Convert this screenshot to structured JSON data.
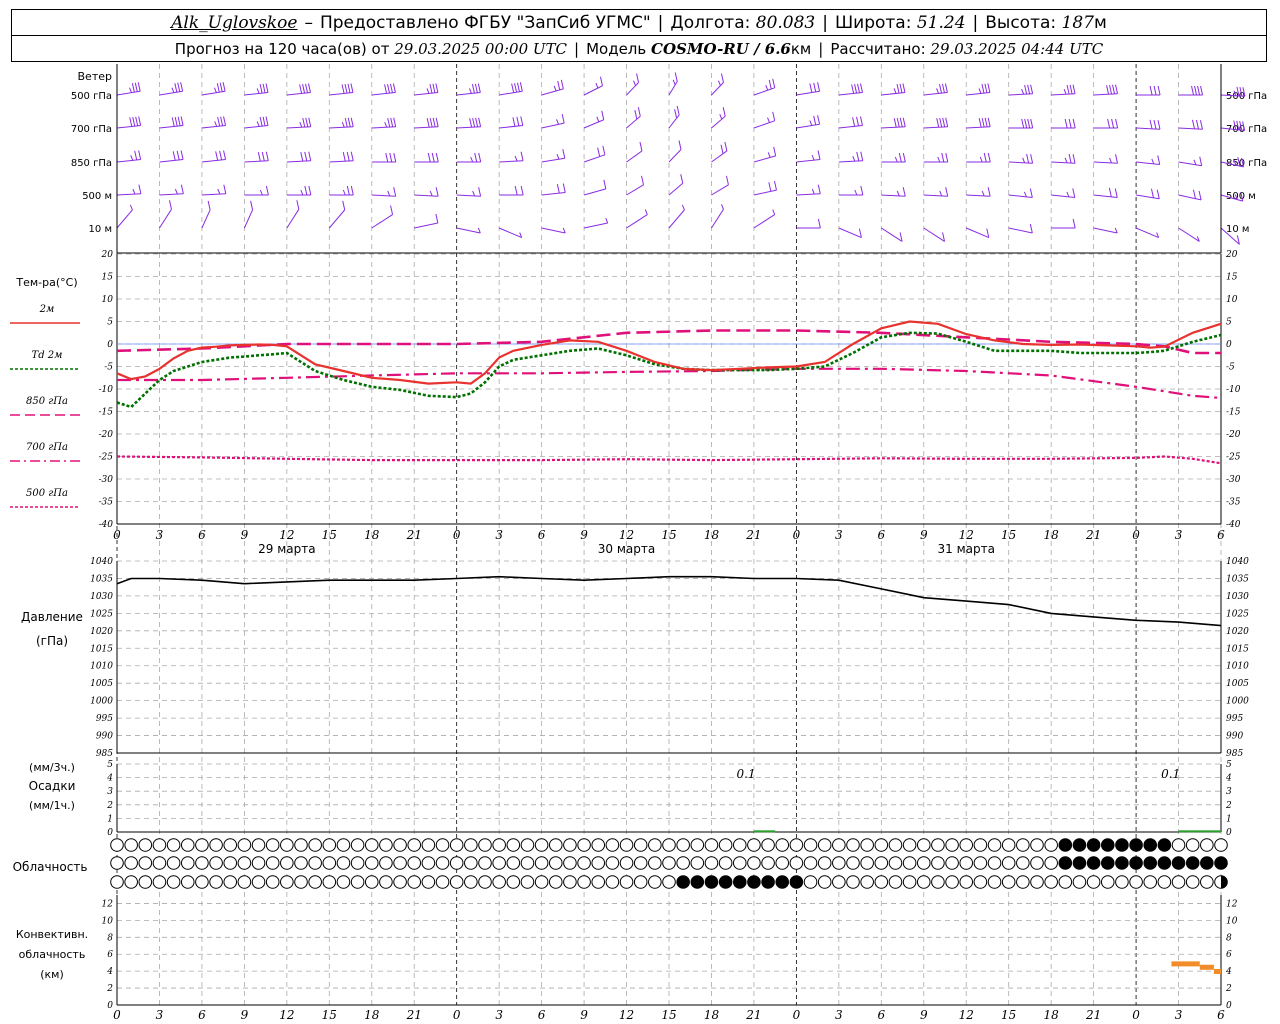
{
  "header": {
    "station": "Alk_Uglovskoe",
    "provider": "Предоставлено ФГБУ \"ЗапСиб УГМС\"",
    "lon_label": "Долгота:",
    "lon": "80.083",
    "lat_label": "Широта:",
    "lat": "51.24",
    "alt_label": "Высота:",
    "alt": "187",
    "alt_unit": "м",
    "forecast_label": "Прогноз на 120 часа(ов) от",
    "forecast_start": "29.03.2025 00:00 UTC",
    "model_label": "Модель",
    "model": "COSMO-RU / 6.6",
    "model_unit": "км",
    "computed_label": "Рассчитано:",
    "computed": "29.03.2025 04:44 UTC"
  },
  "colors": {
    "wind": "#8a2be2",
    "t2m": "#e8322e",
    "td2m": "#007000",
    "t850": "#e0107a",
    "t700": "#e0107a",
    "t500": "#e0107a",
    "pressure": "#000000",
    "conv": "#f28c28",
    "precip": "#2ca02c",
    "grid": "#aaaaaa"
  },
  "chart_data": {
    "x": {
      "hours": [
        0,
        3,
        6,
        9,
        12,
        15,
        18,
        21,
        24,
        27,
        30,
        33,
        36,
        39,
        42,
        45,
        48,
        51,
        54,
        57,
        60,
        63,
        66,
        69,
        72,
        75,
        78
      ],
      "tick_labels": [
        "0",
        "3",
        "6",
        "9",
        "12",
        "15",
        "18",
        "21",
        "0",
        "3",
        "6",
        "9",
        "12",
        "15",
        "18",
        "21",
        "0",
        "3",
        "6",
        "9",
        "12",
        "15",
        "18",
        "21",
        "0",
        "3",
        "6"
      ],
      "dates": [
        {
          "label": "29 марта",
          "hour": 12
        },
        {
          "label": "30 марта",
          "hour": 36
        },
        {
          "label": "31 марта",
          "hour": 60
        }
      ]
    },
    "wind": {
      "title": "Ветер",
      "levels": [
        "500 гПа",
        "700 гПа",
        "850 гПа",
        "500 м",
        "10 м"
      ],
      "speed_ms": [
        [
          22,
          23,
          24,
          24,
          25,
          25,
          25,
          24,
          22,
          18,
          14,
          12,
          10,
          10,
          12,
          14,
          16,
          18,
          20,
          20,
          20,
          20,
          20,
          18,
          16,
          18,
          20
        ],
        [
          18,
          19,
          20,
          20,
          21,
          21,
          20,
          19,
          18,
          15,
          12,
          10,
          8,
          8,
          10,
          12,
          14,
          16,
          18,
          18,
          18,
          18,
          17,
          16,
          15,
          16,
          18
        ],
        [
          14,
          15,
          16,
          16,
          17,
          17,
          16,
          15,
          14,
          12,
          10,
          8,
          6,
          6,
          8,
          10,
          12,
          13,
          14,
          14,
          14,
          14,
          13,
          12,
          11,
          12,
          14
        ],
        [
          11,
          12,
          12,
          12,
          13,
          13,
          12,
          11,
          10,
          9,
          8,
          6,
          5,
          5,
          6,
          8,
          10,
          11,
          12,
          12,
          11,
          11,
          10,
          9,
          8,
          9,
          11
        ],
        [
          4,
          5,
          5,
          5,
          6,
          6,
          5,
          5,
          4,
          4,
          4,
          3,
          3,
          3,
          3,
          4,
          5,
          5,
          6,
          6,
          6,
          5,
          5,
          4,
          4,
          4,
          5
        ]
      ],
      "dir_deg": [
        [
          285,
          285,
          285,
          280,
          280,
          280,
          280,
          280,
          280,
          285,
          295,
          310,
          330,
          340,
          330,
          300,
          285,
          280,
          280,
          280,
          280,
          275,
          275,
          275,
          270,
          270,
          265
        ],
        [
          280,
          280,
          280,
          280,
          275,
          275,
          275,
          275,
          275,
          280,
          290,
          305,
          325,
          335,
          325,
          300,
          285,
          280,
          275,
          275,
          275,
          270,
          270,
          270,
          265,
          265,
          260
        ],
        [
          280,
          280,
          280,
          275,
          275,
          275,
          270,
          270,
          270,
          275,
          285,
          300,
          320,
          330,
          320,
          295,
          280,
          275,
          270,
          270,
          270,
          265,
          265,
          265,
          260,
          255,
          250
        ],
        [
          275,
          275,
          275,
          270,
          270,
          270,
          265,
          265,
          265,
          270,
          280,
          295,
          315,
          325,
          315,
          290,
          275,
          270,
          265,
          265,
          265,
          260,
          260,
          260,
          255,
          250,
          245
        ],
        [
          320,
          330,
          340,
          340,
          330,
          320,
          300,
          280,
          260,
          250,
          260,
          280,
          300,
          320,
          330,
          300,
          270,
          250,
          240,
          240,
          250,
          260,
          270,
          260,
          250,
          240,
          230
        ]
      ]
    },
    "temperature": {
      "title": "Тем-ра(°C)",
      "ylim": [
        -40,
        20
      ],
      "yticks": [
        20,
        15,
        10,
        5,
        0,
        -5,
        -10,
        -15,
        -20,
        -25,
        -30,
        -35,
        -40
      ],
      "series": [
        {
          "name": "2м",
          "hours": [
            0,
            1,
            2,
            3,
            4,
            5,
            6,
            7,
            8,
            9,
            10,
            11,
            12,
            14,
            16,
            18,
            20,
            22,
            24,
            25,
            26,
            27,
            28,
            30,
            32,
            34,
            36,
            38,
            40,
            42,
            44,
            46,
            48,
            50,
            52,
            54,
            56,
            58,
            60,
            62,
            64,
            66,
            68,
            70,
            72,
            73,
            74,
            76,
            78
          ],
          "values": [
            -6.5,
            -7.8,
            -7.2,
            -5.5,
            -3.2,
            -1.5,
            -0.8,
            -0.6,
            -0.3,
            -0.2,
            -0.1,
            -0.2,
            -0.5,
            -4.5,
            -6.0,
            -7.5,
            -8.0,
            -8.8,
            -8.5,
            -8.8,
            -6.5,
            -3.0,
            -1.5,
            -0.2,
            0.8,
            0.5,
            -1.5,
            -4.0,
            -5.5,
            -5.8,
            -5.5,
            -5.2,
            -5.0,
            -4.0,
            0.0,
            3.5,
            5.0,
            4.5,
            2.2,
            0.8,
            0.0,
            -0.2,
            -0.1,
            -0.3,
            -0.5,
            -0.8,
            -0.6,
            2.5,
            4.5
          ]
        },
        {
          "name": "Td 2м",
          "hours": [
            0,
            1,
            2,
            3,
            4,
            5,
            6,
            7,
            8,
            9,
            10,
            11,
            12,
            14,
            16,
            18,
            20,
            22,
            24,
            25,
            26,
            27,
            28,
            30,
            32,
            34,
            36,
            38,
            40,
            42,
            44,
            46,
            48,
            50,
            52,
            54,
            56,
            58,
            60,
            62,
            64,
            66,
            68,
            70,
            72,
            73,
            74,
            76,
            78
          ],
          "values": [
            -13,
            -14,
            -11,
            -8,
            -6,
            -5,
            -4,
            -3.5,
            -3,
            -2.8,
            -2.5,
            -2.3,
            -2.0,
            -6.0,
            -8.0,
            -9.5,
            -10.2,
            -11.5,
            -11.8,
            -11.0,
            -8.5,
            -5.0,
            -3.5,
            -2.5,
            -1.5,
            -1.0,
            -2.5,
            -4.5,
            -5.5,
            -5.8,
            -5.8,
            -5.8,
            -5.5,
            -5.0,
            -2.0,
            1.5,
            2.5,
            2.3,
            0.5,
            -1.5,
            -1.5,
            -1.5,
            -2.0,
            -2.0,
            -2.0,
            -1.8,
            -1.5,
            0.5,
            2.0
          ]
        },
        {
          "name": "850 гПа",
          "style": "dashed",
          "hours": [
            0,
            6,
            12,
            18,
            24,
            30,
            36,
            42,
            48,
            54,
            60,
            66,
            72,
            74,
            76,
            78
          ],
          "values": [
            -1.5,
            -1.0,
            0.0,
            0.0,
            0.0,
            0.5,
            2.5,
            3.0,
            3.0,
            2.5,
            1.5,
            0.5,
            0.0,
            -0.5,
            -2.0,
            -2.0
          ]
        },
        {
          "name": "700 гПа",
          "style": "dashdot",
          "hours": [
            0,
            6,
            12,
            18,
            24,
            30,
            36,
            42,
            48,
            54,
            60,
            66,
            72,
            74,
            76,
            78
          ],
          "values": [
            -8.0,
            -8.0,
            -7.5,
            -7.0,
            -6.5,
            -6.5,
            -6.2,
            -6.0,
            -5.5,
            -5.5,
            -6.0,
            -7.0,
            -9.5,
            -10.5,
            -11.5,
            -12.0
          ]
        },
        {
          "name": "500 гПа",
          "style": "dotted",
          "hours": [
            0,
            6,
            12,
            18,
            24,
            30,
            36,
            42,
            48,
            54,
            60,
            66,
            72,
            74,
            76,
            78
          ],
          "values": [
            -25.0,
            -25.2,
            -25.5,
            -25.8,
            -25.8,
            -25.8,
            -25.6,
            -25.8,
            -25.6,
            -25.4,
            -25.5,
            -25.5,
            -25.3,
            -25.0,
            -25.5,
            -26.5
          ]
        }
      ]
    },
    "pressure": {
      "title": "Давление",
      "unit": "(гПа)",
      "ylim": [
        985,
        1040
      ],
      "yticks": [
        1040,
        1035,
        1030,
        1025,
        1020,
        1015,
        1010,
        1005,
        1000,
        995,
        990,
        985
      ],
      "hours": [
        0,
        1,
        3,
        6,
        9,
        12,
        15,
        18,
        21,
        24,
        27,
        30,
        33,
        36,
        39,
        42,
        45,
        48,
        51,
        54,
        57,
        60,
        63,
        66,
        69,
        72,
        75,
        78
      ],
      "values": [
        1033.5,
        1035.0,
        1035.0,
        1034.5,
        1033.5,
        1034.0,
        1034.5,
        1034.5,
        1034.5,
        1035.0,
        1035.5,
        1035.0,
        1034.5,
        1035.0,
        1035.5,
        1035.5,
        1035.0,
        1035.0,
        1034.5,
        1032.0,
        1029.5,
        1028.5,
        1027.5,
        1025.0,
        1024.0,
        1023.0,
        1022.5,
        1021.5
      ]
    },
    "precipitation": {
      "title": "Осадки",
      "unit_3h": "(мм/3ч.)",
      "unit_1h": "(мм/1ч.)",
      "ylim": [
        0,
        5
      ],
      "yticks": [
        5,
        4,
        3,
        2,
        1,
        0
      ],
      "annotations": [
        {
          "text": "0.1",
          "hour": 46
        },
        {
          "text": "0.1",
          "hour": 76
        }
      ],
      "bars": [
        {
          "hour_start": 45,
          "hour_end": 46.5,
          "value": 0.05
        },
        {
          "hour_start": 75,
          "hour_end": 78,
          "value": 0.05
        }
      ]
    },
    "clouds": {
      "title": "Облачность",
      "step_hours": 1,
      "rows": [
        {
          "level": "high",
          "full": [
            [
              67,
              74
            ]
          ],
          "half": [
            67,
            71
          ]
        },
        {
          "level": "middle",
          "full": [
            [
              67,
              78
            ]
          ],
          "half": [
            67,
            69
          ]
        },
        {
          "level": "low",
          "full": [
            [
              40,
              48
            ]
          ],
          "half": [
            48,
            78
          ]
        }
      ]
    },
    "convective": {
      "title": "Конвективн.",
      "title2": "облачность",
      "unit": "(км)",
      "ylim": [
        0,
        13
      ],
      "yticks": [
        12,
        10,
        8,
        6,
        4,
        2,
        0
      ],
      "segments": [
        {
          "hour_start": 74.5,
          "hour_end": 76.5,
          "value": 4.8
        },
        {
          "hour_start": 76.5,
          "hour_end": 77.5,
          "value": 4.4
        },
        {
          "hour_start": 77.5,
          "hour_end": 78,
          "value": 3.9
        }
      ]
    }
  }
}
